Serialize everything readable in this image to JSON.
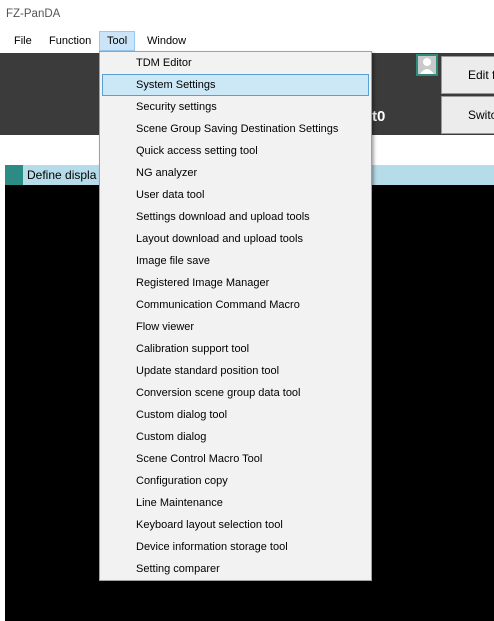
{
  "window": {
    "title": "FZ-PanDA"
  },
  "menubar": {
    "items": [
      {
        "label": "File"
      },
      {
        "label": "Function"
      },
      {
        "label": "Tool"
      },
      {
        "label": "Window"
      }
    ]
  },
  "toolbar": {
    "edit_label": "Edit f",
    "switch_label": "Switch",
    "scene_text": "t0"
  },
  "define_bar": {
    "label": "Define displa"
  },
  "tool_menu": {
    "items": [
      {
        "label": "TDM Editor"
      },
      {
        "label": "System Settings",
        "highlighted": true
      },
      {
        "label": "Security settings"
      },
      {
        "label": "Scene Group Saving Destination Settings"
      },
      {
        "label": "Quick access setting tool"
      },
      {
        "label": "NG analyzer"
      },
      {
        "label": "User data tool"
      },
      {
        "label": "Settings download and upload tools"
      },
      {
        "label": "Layout download and upload tools"
      },
      {
        "label": "Image file save"
      },
      {
        "label": "Registered Image Manager"
      },
      {
        "label": "Communication Command Macro"
      },
      {
        "label": "Flow viewer"
      },
      {
        "label": "Calibration support tool"
      },
      {
        "label": "Update standard position tool"
      },
      {
        "label": "Conversion scene group data tool"
      },
      {
        "label": "Custom dialog tool"
      },
      {
        "label": "Custom dialog"
      },
      {
        "label": "Scene Control Macro Tool"
      },
      {
        "label": "Configuration copy"
      },
      {
        "label": "Line Maintenance"
      },
      {
        "label": "Keyboard layout selection tool"
      },
      {
        "label": "Device information storage tool"
      },
      {
        "label": "Setting comparer"
      }
    ]
  }
}
